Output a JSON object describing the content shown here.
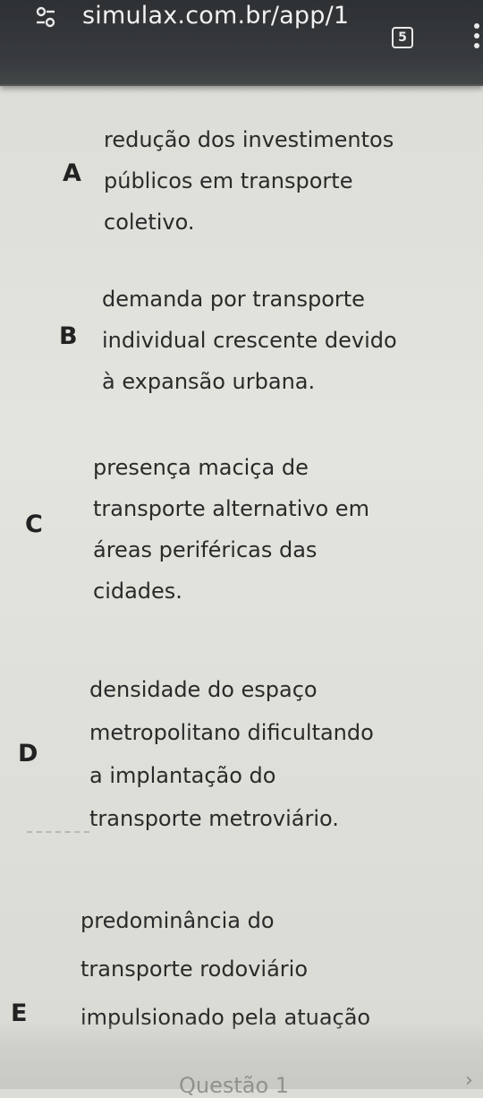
{
  "browser": {
    "url": "simulax.com.br/app/1",
    "tab_count": "5"
  },
  "options": [
    {
      "letter": "A",
      "lines": [
        "redução dos investimentos",
        "públicos em transporte",
        "coletivo."
      ]
    },
    {
      "letter": "B",
      "lines": [
        "demanda por transporte",
        "individual crescente devido",
        "à expansão urbana."
      ]
    },
    {
      "letter": "C",
      "lines": [
        "presença maciça de",
        "transporte alternativo em",
        "áreas periféricas das",
        "cidades."
      ]
    },
    {
      "letter": "D",
      "lines": [
        "densidade do espaço",
        "metropolitano dificultando",
        "a implantação do",
        "transporte metroviário."
      ]
    },
    {
      "letter": "E",
      "lines": [
        "predominância do",
        "transporte rodoviário",
        "impulsionado pela atuação"
      ]
    }
  ],
  "footer": {
    "partial_text": "Questão 1",
    "chevron": "›"
  }
}
